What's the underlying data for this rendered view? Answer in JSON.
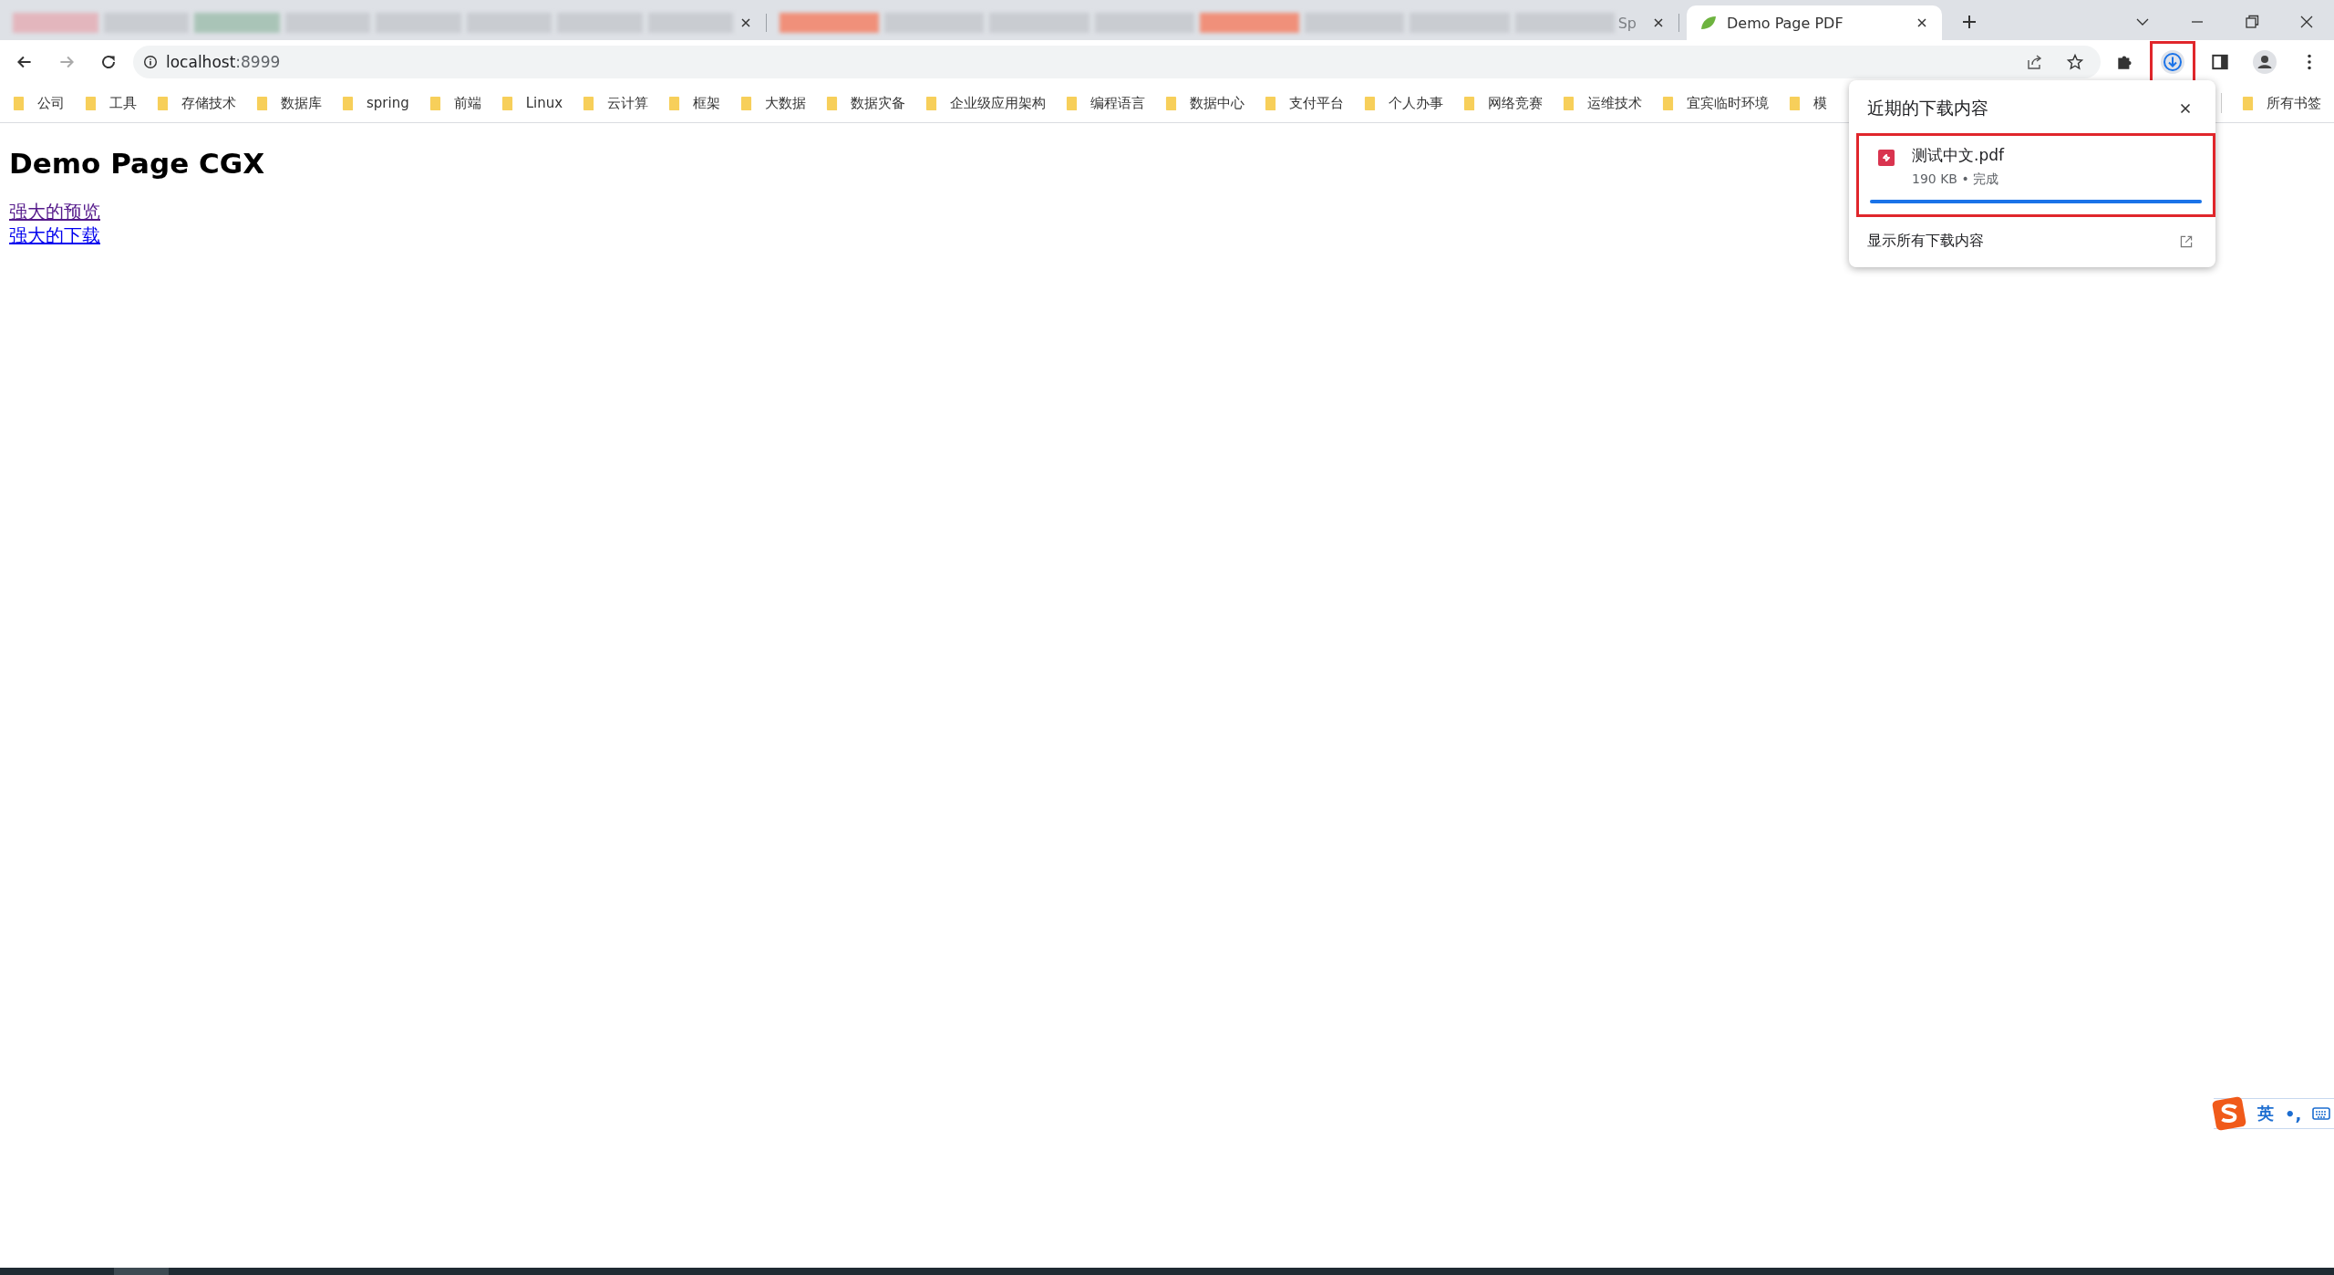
{
  "tabs": [
    {
      "kind": "blurred",
      "selected": false
    },
    {
      "kind": "blurred",
      "title": "Sp",
      "selected": false
    },
    {
      "kind": "site",
      "title": "Demo Page PDF",
      "selected": true
    }
  ],
  "address_bar": {
    "host": "localhost",
    "port": ":8999"
  },
  "toolbar": {
    "downloads_highlighted": true
  },
  "bookmarks": [
    "公司",
    "工具",
    "存储技术",
    "数据库",
    "spring",
    "前端",
    "Linux",
    "云计算",
    "框架",
    "大数据",
    "数据灾备",
    "企业级应用架构",
    "编程语言",
    "数据中心",
    "支付平台",
    "个人办事",
    "网络竞赛",
    "运维技术",
    "宜宾临时环境",
    "模"
  ],
  "all_bookmarks": "所有书签",
  "page": {
    "heading": "Demo Page CGX",
    "links": [
      {
        "text": "强大的预览",
        "visited": true
      },
      {
        "text": "强大的下载",
        "visited": false
      }
    ]
  },
  "downloads_popup": {
    "title": "近期的下载内容",
    "items": [
      {
        "file_name": "测试中文.pdf",
        "status": "190 KB • 完成",
        "level": 1,
        "highlighted": true
      }
    ],
    "show_all": "显示所有下载内容"
  },
  "ime": {
    "mode": "英",
    "punctuation": "•,"
  }
}
